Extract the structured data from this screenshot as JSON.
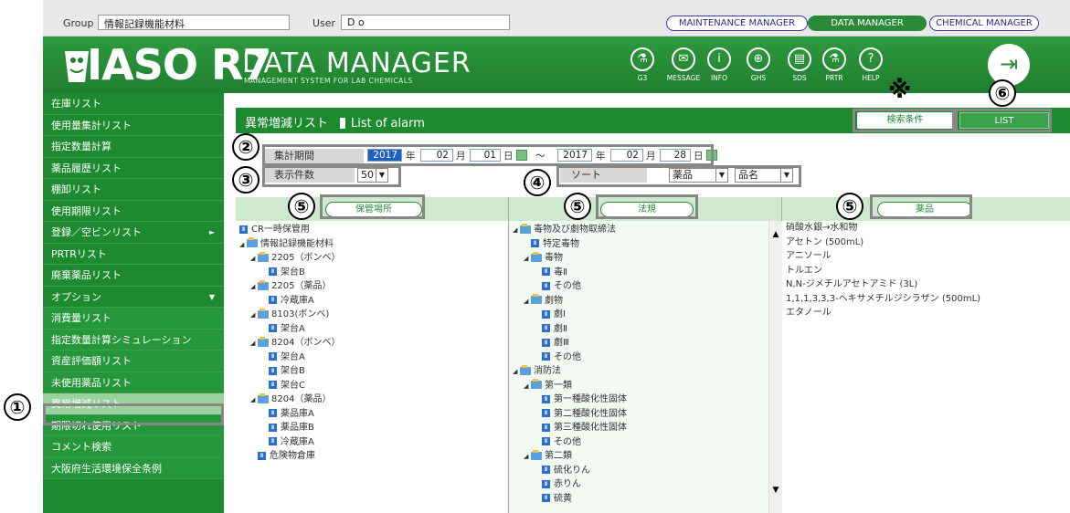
{
  "topbar": {
    "group_label": "Group",
    "group_value": "情報記録機能材料",
    "user_label": "User",
    "user_value": "D o",
    "roles": [
      "MAINTENANCE MANAGER",
      "DATA MANAGER",
      "CHEMICAL MANAGER"
    ],
    "active_role": "DATA MANAGER"
  },
  "header": {
    "logo": "IASO R7",
    "title": "DATA MANAGER",
    "subtitle": "MANAGEMENT SYSTEM FOR LAB CHEMICALS",
    "icons": [
      {
        "name": "g3-icon",
        "label": "G3",
        "glyph": "⚗"
      },
      {
        "name": "message-icon",
        "label": "MESSAGE",
        "glyph": "✉"
      },
      {
        "name": "info-icon",
        "label": "INFO",
        "glyph": "i"
      },
      {
        "name": "ghs-icon",
        "label": "GHS",
        "glyph": "⊕"
      },
      {
        "name": "sds-icon",
        "label": "SDS",
        "glyph": "▤"
      },
      {
        "name": "prtr-icon",
        "label": "PRTR",
        "glyph": "⚗"
      },
      {
        "name": "help-icon",
        "label": "HELP",
        "glyph": "?"
      }
    ]
  },
  "sidebar": {
    "items": [
      {
        "label": "在庫リスト",
        "type": "main"
      },
      {
        "label": "使用量集計リスト",
        "type": "main"
      },
      {
        "label": "指定数量計算",
        "type": "main"
      },
      {
        "label": "薬品履歴リスト",
        "type": "main"
      },
      {
        "label": "棚卸リスト",
        "type": "main"
      },
      {
        "label": "使用期限リスト",
        "type": "main"
      },
      {
        "label": "登録／空ビンリスト",
        "type": "main",
        "arrow": "►"
      },
      {
        "label": "PRTRリスト",
        "type": "main"
      },
      {
        "label": "廃棄薬品リスト",
        "type": "main"
      },
      {
        "label": "オプション",
        "type": "main",
        "arrow": "▼"
      },
      {
        "label": "消費量リスト",
        "type": "sub"
      },
      {
        "label": "指定数量計算シミュレーション",
        "type": "sub"
      },
      {
        "label": "資産評価額リスト",
        "type": "sub"
      },
      {
        "label": "未使用薬品リスト",
        "type": "sub"
      },
      {
        "label": "異常増減リスト",
        "type": "active"
      },
      {
        "label": "期限切れ使用リスト",
        "type": "sub"
      },
      {
        "label": "コメント検索",
        "type": "sub"
      },
      {
        "label": "大阪府生活環境保全条例",
        "type": "sub"
      }
    ]
  },
  "page": {
    "title": "異常増減リスト",
    "title_en": "List of alarm",
    "search_button": "検索条件",
    "list_button": "LIST"
  },
  "filters": {
    "period_label": "集計期間",
    "start_year": "2017",
    "year_unit": "年",
    "start_month": "02",
    "month_unit": "月",
    "start_day": "01",
    "day_unit": "日",
    "tilde": "～",
    "end_year": "2017",
    "end_month": "02",
    "end_day": "28",
    "count_label": "表示件数",
    "count_value": "50",
    "sort_label": "ソート",
    "sort1": "薬品",
    "sort2": "品名"
  },
  "columns": {
    "storage": "保管場所",
    "law": "法規",
    "chemical": "薬品"
  },
  "storage_tree": [
    {
      "t": "CR一時保管用",
      "lvl": 0,
      "k": "leaf"
    },
    {
      "t": "情報記録機能材料",
      "lvl": 0,
      "k": "fold"
    },
    {
      "t": "2205（ボンベ）",
      "lvl": 1,
      "k": "fold"
    },
    {
      "t": "架台B",
      "lvl": 2,
      "k": "leaf"
    },
    {
      "t": "2205（薬品）",
      "lvl": 1,
      "k": "fold"
    },
    {
      "t": "冷蔵庫A",
      "lvl": 2,
      "k": "leaf"
    },
    {
      "t": "8103(ボンベ)",
      "lvl": 1,
      "k": "fold"
    },
    {
      "t": "架台A",
      "lvl": 2,
      "k": "leaf"
    },
    {
      "t": "8204（ボンベ）",
      "lvl": 1,
      "k": "fold"
    },
    {
      "t": "架台A",
      "lvl": 2,
      "k": "leaf"
    },
    {
      "t": "架台B",
      "lvl": 2,
      "k": "leaf"
    },
    {
      "t": "架台C",
      "lvl": 2,
      "k": "leaf"
    },
    {
      "t": "8204（薬品）",
      "lvl": 1,
      "k": "fold"
    },
    {
      "t": "薬品庫A",
      "lvl": 2,
      "k": "leaf"
    },
    {
      "t": "薬品庫B",
      "lvl": 2,
      "k": "leaf"
    },
    {
      "t": "冷蔵庫A",
      "lvl": 2,
      "k": "leaf"
    },
    {
      "t": "危険物倉庫",
      "lvl": 1,
      "k": "leaf"
    }
  ],
  "law_tree": [
    {
      "t": "毒物及び劇物取締法",
      "lvl": 0,
      "k": "fold"
    },
    {
      "t": "特定毒物",
      "lvl": 1,
      "k": "leaf"
    },
    {
      "t": "毒物",
      "lvl": 1,
      "k": "fold"
    },
    {
      "t": "毒Ⅱ",
      "lvl": 2,
      "k": "leaf"
    },
    {
      "t": "その他",
      "lvl": 2,
      "k": "leaf"
    },
    {
      "t": "劇物",
      "lvl": 1,
      "k": "fold"
    },
    {
      "t": "劇Ⅰ",
      "lvl": 2,
      "k": "leaf"
    },
    {
      "t": "劇Ⅱ",
      "lvl": 2,
      "k": "leaf"
    },
    {
      "t": "劇Ⅲ",
      "lvl": 2,
      "k": "leaf"
    },
    {
      "t": "その他",
      "lvl": 2,
      "k": "leaf"
    },
    {
      "t": "消防法",
      "lvl": 0,
      "k": "fold"
    },
    {
      "t": "第一類",
      "lvl": 1,
      "k": "fold"
    },
    {
      "t": "第一種酸化性固体",
      "lvl": 2,
      "k": "leaf"
    },
    {
      "t": "第二種酸化性固体",
      "lvl": 2,
      "k": "leaf"
    },
    {
      "t": "第三種酸化性固体",
      "lvl": 2,
      "k": "leaf"
    },
    {
      "t": "その他",
      "lvl": 2,
      "k": "leaf"
    },
    {
      "t": "第二類",
      "lvl": 1,
      "k": "fold"
    },
    {
      "t": "硫化りん",
      "lvl": 2,
      "k": "leaf"
    },
    {
      "t": "赤りん",
      "lvl": 2,
      "k": "leaf"
    },
    {
      "t": "硫黄",
      "lvl": 2,
      "k": "leaf"
    }
  ],
  "chemicals": [
    "硝酸水銀→水和物",
    "アセトン (500mL)",
    "アニソール",
    "トルエン",
    "N,N-ジメチルアセトアミド (3L)",
    "1,1,1,3,3,3-ヘキサメチルジシラザン (500mL)",
    "エタノール"
  ],
  "annotations": {
    "n1": "①",
    "n2": "②",
    "n3": "③",
    "n4": "④",
    "n5": "⑤",
    "n6": "⑥",
    "kome": "※"
  }
}
